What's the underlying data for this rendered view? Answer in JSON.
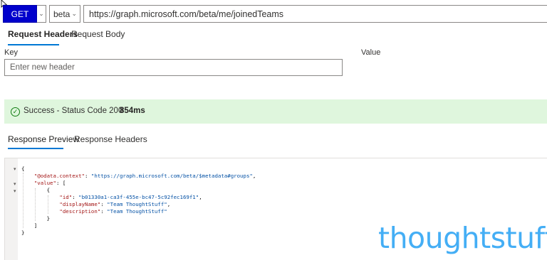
{
  "request": {
    "method": "GET",
    "version": "beta",
    "url": "https://graph.microsoft.com/beta/me/joinedTeams"
  },
  "request_tabs": {
    "headers": "Request Headers",
    "body": "Request Body"
  },
  "headers_form": {
    "key_label": "Key",
    "value_label": "Value",
    "key_placeholder": "Enter new header"
  },
  "status": {
    "text": "Success - Status Code 200",
    "time": "854ms",
    "color": "#dff6dd"
  },
  "response_tabs": {
    "preview": "Response Preview",
    "headers": "Response Headers"
  },
  "response": {
    "lines": [
      "{",
      "    \"@odata.context\": \"https://graph.microsoft.com/beta/$metadata#groups\",",
      "    \"value\": [",
      "        {",
      "            \"id\": \"b01330a1-ca3f-455e-bc47-5c92fec169f1\",",
      "            \"displayName\": \"Team ThoughtStuff\",",
      "            \"description\": \"Team ThoughtStuff\"",
      "        }",
      "    ]",
      "}"
    ]
  },
  "watermark": "thoughtstuff",
  "colors": {
    "accent": "#0078d4",
    "method_button": "#0000cc",
    "watermark": "#44aef5"
  }
}
